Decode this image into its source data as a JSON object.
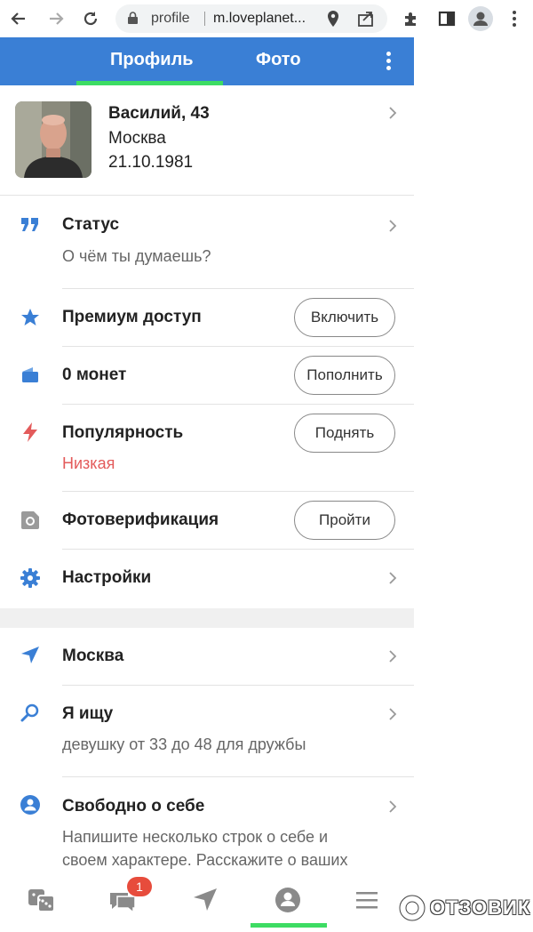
{
  "browser": {
    "tab_text": "profile",
    "url": "m.loveplanet..."
  },
  "header": {
    "tabs": [
      "Профиль",
      "Фото"
    ]
  },
  "profile": {
    "name": "Василий, 43",
    "city": "Москва",
    "birthdate": "21.10.1981"
  },
  "rows": {
    "status": {
      "label": "Статус",
      "sub": "О чём ты думаешь?"
    },
    "premium": {
      "label": "Премиум доступ",
      "button": "Включить"
    },
    "coins": {
      "label": "0 монет",
      "button": "Пополнить"
    },
    "popularity": {
      "label": "Популярность",
      "sub": "Низкая",
      "button": "Поднять"
    },
    "verify": {
      "label": "Фотоверификация",
      "button": "Пройти"
    },
    "settings": {
      "label": "Настройки"
    },
    "location": {
      "label": "Москва"
    },
    "seeking": {
      "label": "Я ищу",
      "sub": "девушку от 33 до 48 для дружбы"
    },
    "about": {
      "label": "Свободно о себе",
      "sub1": "Напишите несколько строк о себе и",
      "sub2": "своем характере. Расскажите о ваших"
    }
  },
  "bottom_nav": {
    "messages_badge": "1"
  },
  "watermark": "ОТЗОВИК",
  "colors": {
    "header_blue": "#3a7fd5",
    "accent_green": "#3ddc63",
    "icon_blue": "#3a7fd5",
    "red": "#e35b5b"
  }
}
